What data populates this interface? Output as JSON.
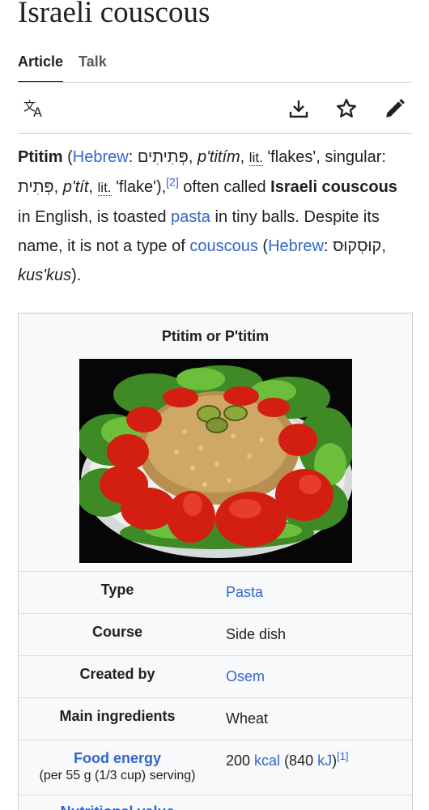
{
  "page": {
    "title": "Israeli couscous"
  },
  "tabs": [
    {
      "label": "Article",
      "active": true
    },
    {
      "label": "Talk",
      "active": false
    }
  ],
  "toolbar": {
    "language_icon": "translate-icon",
    "download_icon": "download-icon",
    "watch_icon": "star-icon",
    "edit_icon": "pencil-icon"
  },
  "lead": {
    "term": "Ptitim",
    "open_paren": " (",
    "hebrew_link": "Hebrew",
    "colon": ": ",
    "hebrew_word": "פְּתִיתִים",
    "comma1": ", ",
    "translit": "p'titím",
    "comma2": ", ",
    "lit": "lit.",
    "meaning": " 'flakes', singular: ",
    "singular_hebrew": "פְּתִית",
    "comma3": ", ",
    "singular_translit": "p'tít",
    "comma4": ", ",
    "lit2": "lit.",
    "singular_meaning": " 'flake'),",
    "ref": "[2]",
    "often_called": " often called ",
    "alt_name": "Israeli couscous",
    "in_english": " in English, is toasted ",
    "pasta_link": "pasta",
    "tiny_balls": " in tiny balls. Despite its name, it is not a type of ",
    "couscous_link": "couscous",
    "paren2": " (",
    "hebrew_link2": "Hebrew",
    "colon2": ": ",
    "hebrew_couscous": "קוּסְקוּס",
    "comma5": ", ",
    "kuskus": "kus'kus",
    "close": ")."
  },
  "infobox": {
    "caption": "Ptitim or P'titim",
    "image_alt": "Plate of ptitim surrounded by tomato halves and lettuce, topped with olives",
    "rows": [
      {
        "label": "Type",
        "value": "Pasta",
        "value_is_link": true
      },
      {
        "label": "Course",
        "value": "Side dish",
        "value_is_link": false
      },
      {
        "label": "Created by",
        "value": "Osem",
        "value_is_link": true
      },
      {
        "label": "Main ingredients",
        "value": "Wheat",
        "value_is_link": false
      }
    ],
    "energy": {
      "label": "Food energy",
      "sublabel": "(per 55 g (1/3 cup) serving)",
      "value_num": "200 ",
      "kcal_link": "kcal",
      "value_mid": " (840 ",
      "kj_link": "kJ",
      "value_end": ")",
      "ref": "[1]"
    },
    "nutritional_partial": "Nutritional value"
  }
}
